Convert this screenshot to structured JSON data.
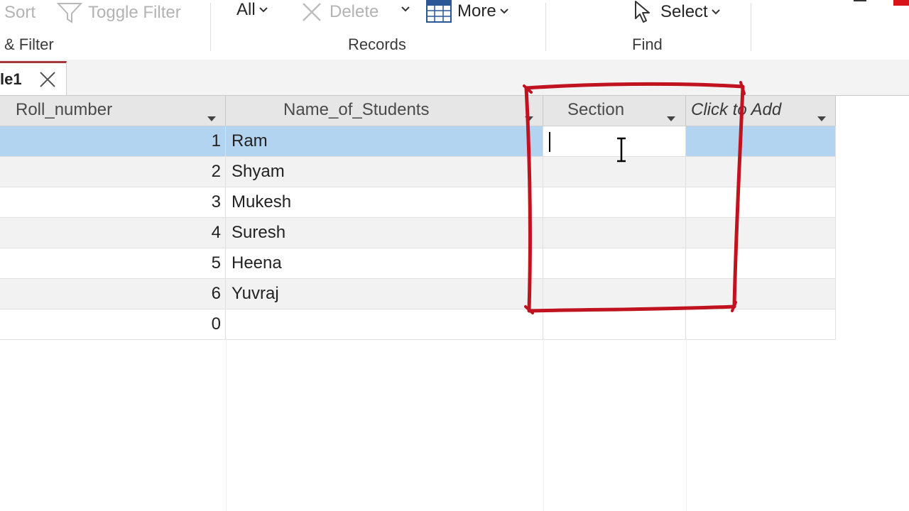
{
  "ribbon": {
    "sort_label": "Sort",
    "toggle_filter_label": "Toggle Filter",
    "sort_filter_group": "& Filter",
    "all_label": "All",
    "delete_label": "Delete",
    "more_label": "More",
    "records_group": "Records",
    "select_label": "Select",
    "find_group": "Find"
  },
  "tab": {
    "label": "le1"
  },
  "table": {
    "columns": [
      {
        "label": "Roll_number"
      },
      {
        "label": "Name_of_Students"
      },
      {
        "label": "Section"
      },
      {
        "label": "Click to Add"
      }
    ],
    "rows": [
      {
        "roll": "1",
        "name": "Ram",
        "section": ""
      },
      {
        "roll": "2",
        "name": "Shyam",
        "section": ""
      },
      {
        "roll": "3",
        "name": "Mukesh",
        "section": ""
      },
      {
        "roll": "4",
        "name": "Suresh",
        "section": ""
      },
      {
        "roll": "5",
        "name": "Heena",
        "section": ""
      },
      {
        "roll": "6",
        "name": "Yuvraj",
        "section": ""
      },
      {
        "roll": "0",
        "name": "",
        "section": ""
      }
    ]
  },
  "colors": {
    "selection": "#b3d4f0",
    "annotation": "#c0121f",
    "tab_accent": "#a4373a",
    "accent_red": "#d8141b"
  },
  "icons": {
    "filter": "filter-funnel-icon",
    "delete": "delete-x-icon",
    "more": "table-grid-icon",
    "select": "cursor-arrow-icon",
    "close": "close-icon",
    "dropdown": "dropdown-arrow-icon",
    "text_cursor": "i-beam-cursor-icon"
  }
}
